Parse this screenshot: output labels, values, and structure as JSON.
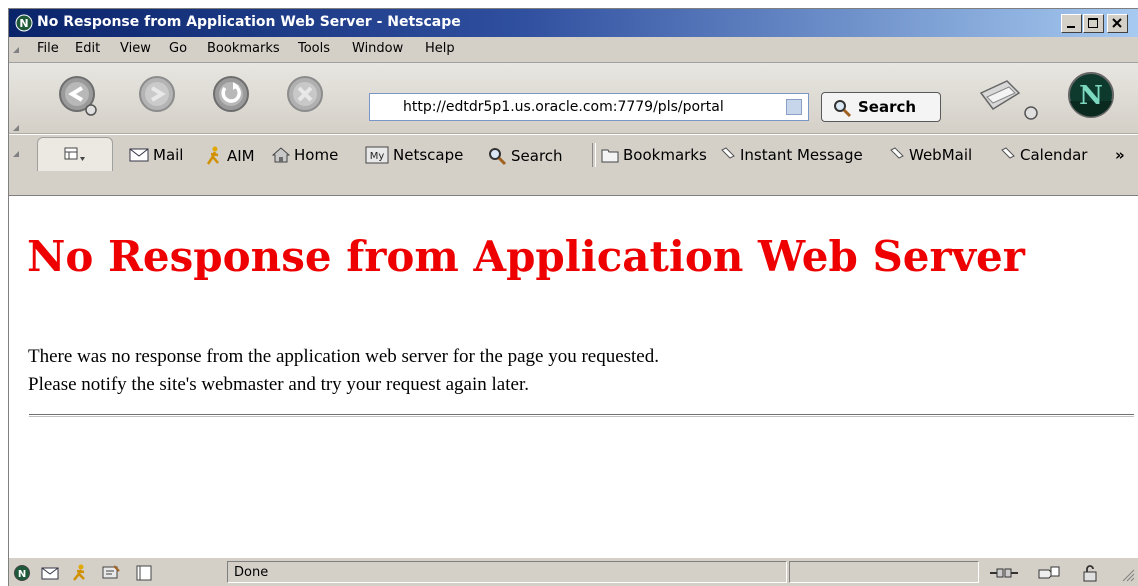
{
  "window": {
    "title": "No Response from Application Web Server - Netscape"
  },
  "menu": [
    "File",
    "Edit",
    "View",
    "Go",
    "Bookmarks",
    "Tools",
    "Window",
    "Help"
  ],
  "navigation": {
    "url": "http://edtdr5p1.us.oracle.com:7779/pls/portal",
    "search_label": "Search"
  },
  "personal_toolbar": {
    "items": [
      "Mail",
      "AIM",
      "Home",
      "Netscape",
      "Search",
      "Bookmarks",
      "Instant Message",
      "WebMail",
      "Calendar"
    ],
    "overflow": "»"
  },
  "page": {
    "heading": "No Response from Application Web Server",
    "line1": "There was no response from the application web server for the page you requested.",
    "line2": "Please notify the site's webmaster and try your request again later."
  },
  "status": {
    "text": "Done"
  },
  "colors": {
    "heading": "#ee0000",
    "titlebar": "#0a246a",
    "chrome": "#d4d0c8"
  }
}
